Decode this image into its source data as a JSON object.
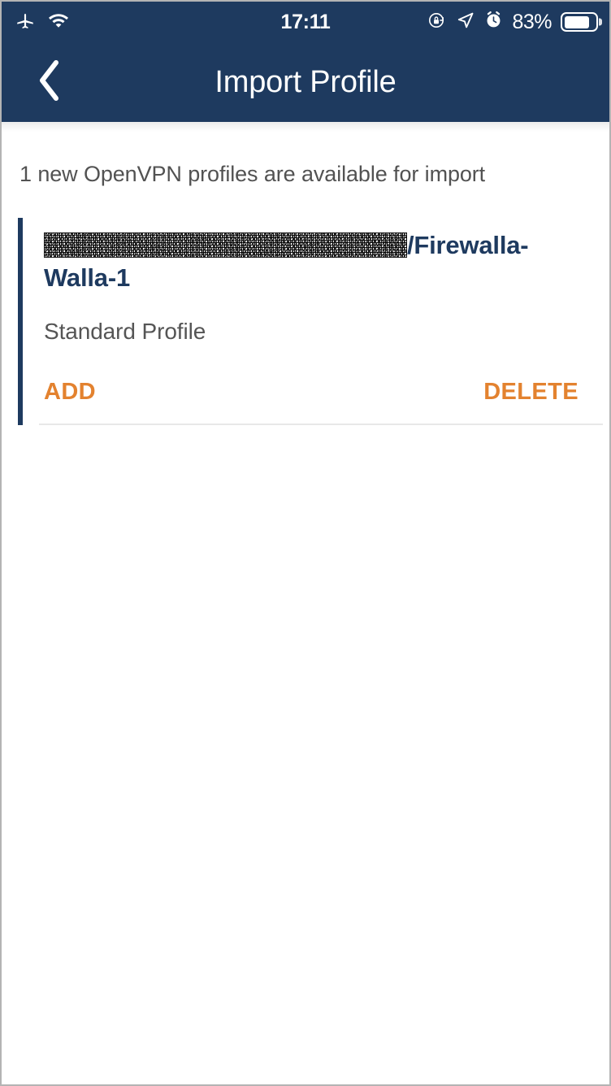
{
  "status_bar": {
    "airplane_icon": "airplane-mode-icon",
    "wifi_icon": "wifi-icon",
    "time": "17:11",
    "rotation_lock_icon": "rotation-lock-icon",
    "location_icon": "location-arrow-icon",
    "alarm_icon": "alarm-clock-icon",
    "battery_percent": "83%",
    "battery_level": 83
  },
  "nav_bar": {
    "back_icon": "chevron-left-icon",
    "title": "Import Profile"
  },
  "content": {
    "subtitle": "1 new OpenVPN profiles are available for import",
    "profile": {
      "name_redacted_prefix": "",
      "name_visible": "/Firewalla-Walla-1",
      "type": "Standard Profile",
      "add_label": "ADD",
      "delete_label": "DELETE"
    }
  },
  "colors": {
    "header_navy": "#1e3a5f",
    "accent_orange": "#e3822f",
    "body_text": "#525252",
    "page_background": "#ffffff"
  }
}
